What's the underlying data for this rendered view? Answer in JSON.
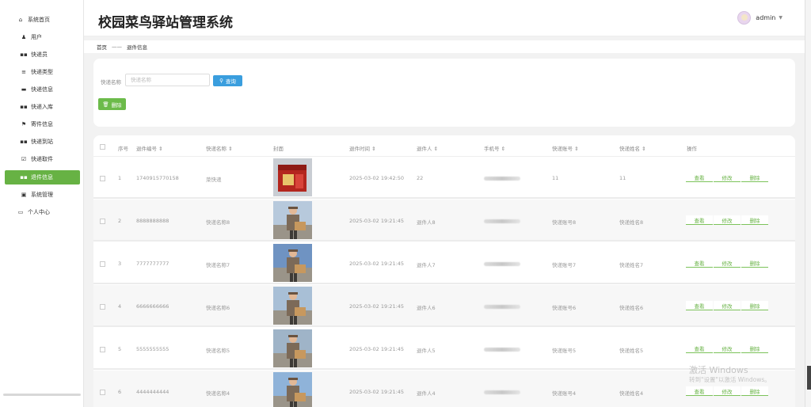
{
  "sidebar": {
    "home": "系统首页",
    "items": [
      {
        "label": "用户",
        "icon": "person-icon"
      },
      {
        "label": "快递员",
        "icon": "grid-icon"
      },
      {
        "label": "快递类型",
        "icon": "list-icon"
      },
      {
        "label": "快递信息",
        "icon": "ticket-icon"
      },
      {
        "label": "快递入库",
        "icon": "grid-icon"
      },
      {
        "label": "寄件信息",
        "icon": "flag-icon"
      },
      {
        "label": "快递到站",
        "icon": "grid-icon"
      },
      {
        "label": "快递取件",
        "icon": "check-icon"
      },
      {
        "label": "退件信息",
        "icon": "grid-icon",
        "active": true
      },
      {
        "label": "系统管理",
        "icon": "clipboard-icon"
      }
    ],
    "personal": "个人中心"
  },
  "header": {
    "title": "校园菜鸟驿站管理系统",
    "user": "admin"
  },
  "breadcrumb": {
    "home": "首页",
    "separator": "——",
    "current": "退件信息"
  },
  "search": {
    "label": "快递名称",
    "placeholder": "快递名称",
    "query_button": "查询",
    "delete_button": "删除"
  },
  "table": {
    "headers": [
      "序号",
      "退件编号",
      "快递名称",
      "封面",
      "退件时间",
      "退件人",
      "手机号",
      "快递账号",
      "快递姓名",
      "操作"
    ],
    "actions": [
      "查看",
      "修改",
      "删除"
    ],
    "rows": [
      {
        "no": "1",
        "code": "1740915770158",
        "name": "菜快递",
        "time": "2025-03-02 19:42:50",
        "person": "22",
        "account": "11",
        "realname": "11",
        "cover": "box"
      },
      {
        "no": "2",
        "code": "8888888888",
        "name": "快递名称8",
        "time": "2025-03-02 19:21:45",
        "person": "退件人8",
        "account": "快递账号8",
        "realname": "快递姓名8",
        "cover": "courier"
      },
      {
        "no": "3",
        "code": "7777777777",
        "name": "快递名称7",
        "time": "2025-03-02 19:21:45",
        "person": "退件人7",
        "account": "快递账号7",
        "realname": "快递姓名7",
        "cover": "courier"
      },
      {
        "no": "4",
        "code": "6666666666",
        "name": "快递名称6",
        "time": "2025-03-02 19:21:45",
        "person": "退件人6",
        "account": "快递账号6",
        "realname": "快递姓名6",
        "cover": "courier"
      },
      {
        "no": "5",
        "code": "5555555555",
        "name": "快递名称5",
        "time": "2025-03-02 19:21:45",
        "person": "退件人5",
        "account": "快递账号5",
        "realname": "快递姓名5",
        "cover": "courier"
      },
      {
        "no": "6",
        "code": "4444444444",
        "name": "快递名称4",
        "time": "2025-03-02 19:21:45",
        "person": "退件人4",
        "account": "快递账号4",
        "realname": "快递姓名4",
        "cover": "courier"
      }
    ]
  },
  "watermark": {
    "line1": "激活 Windows",
    "line2": "转到\"设置\"以激活 Windows。"
  },
  "colors": {
    "accent_green": "#67b244",
    "query_blue": "#3a9ede"
  }
}
